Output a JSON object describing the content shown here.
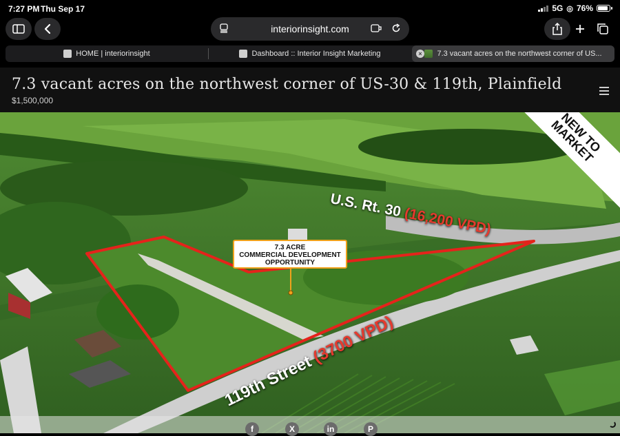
{
  "status": {
    "time": "7:27 PM",
    "date": "Thu Sep 17",
    "network": "5G",
    "battery": "76%"
  },
  "browser": {
    "url": "interiorinsight.com",
    "tabs": [
      {
        "label": "HOME | interiorinsight",
        "active": false
      },
      {
        "label": "Dashboard :: Interior Insight Marketing",
        "active": false
      },
      {
        "label": "7.3 vacant acres on the northwest corner of US...",
        "active": true
      }
    ]
  },
  "page": {
    "title": "7.3 vacant acres on the northwest corner of US-30 & 119th, Plainfield",
    "price": "$1,500,000"
  },
  "hero": {
    "callout_line1": "7.3 ACRE",
    "callout_line2": "COMMERCIAL DEVELOPMENT",
    "callout_line3": "OPPORTUNITY",
    "road1_name": "U.S. Rt. 30",
    "road1_vpd": "(16,200 VPD)",
    "road2_name": "119th Street",
    "road2_vpd": "(3700 VPD)",
    "ribbon": "NEW TO MARKET",
    "boundary_color": "#e5231b",
    "callout_border_color": "#f0a21c"
  },
  "share": [
    "facebook-icon",
    "x-icon",
    "linkedin-icon",
    "pinterest-icon"
  ]
}
